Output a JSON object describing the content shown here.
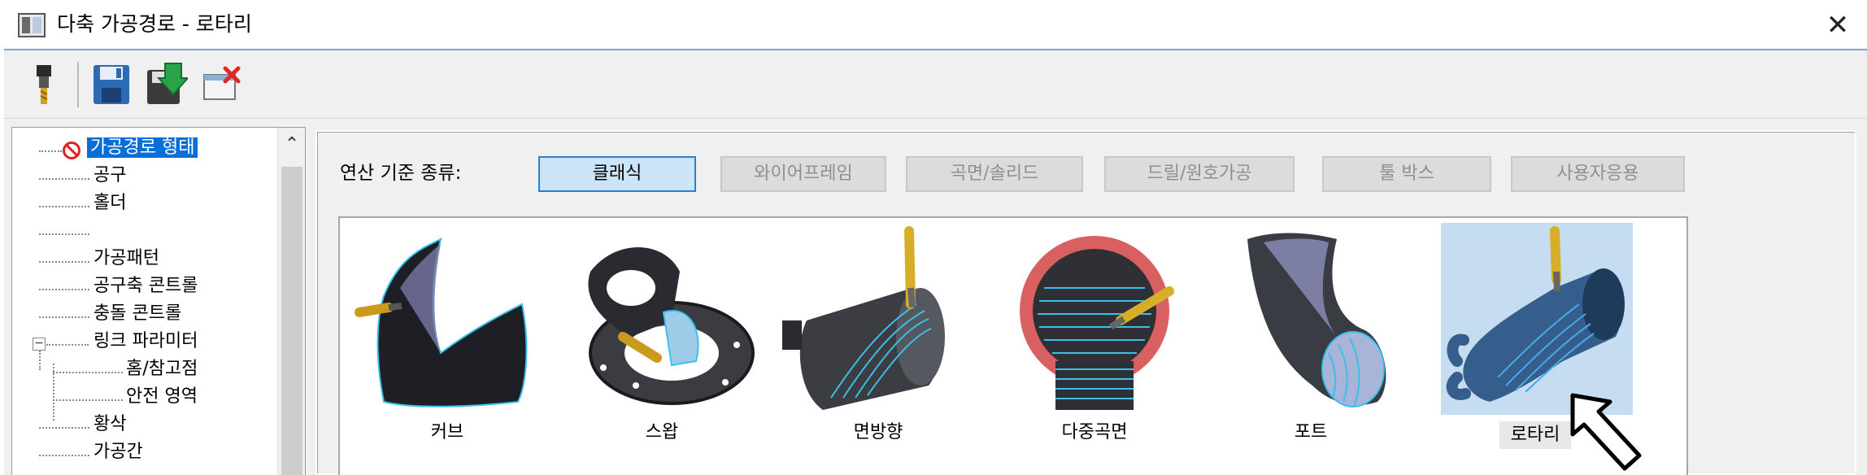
{
  "window": {
    "title": "다축 가공경로 - 로타리",
    "close_label": "✕"
  },
  "toolbar": {
    "buttons": [
      {
        "name": "tool-icon"
      },
      {
        "name": "save-icon"
      },
      {
        "name": "save-apply-icon"
      },
      {
        "name": "cancel-icon"
      }
    ]
  },
  "tree": {
    "items": [
      {
        "label": "가공경로 형태",
        "selected": true
      },
      {
        "label": "공구"
      },
      {
        "label": "홀더"
      },
      {
        "label": ""
      },
      {
        "label": "가공패턴"
      },
      {
        "label": "공구축 콘트롤"
      },
      {
        "label": "충돌 콘트롤"
      },
      {
        "label": "링크 파라미터"
      },
      {
        "label": "홈/참고점"
      },
      {
        "label": "안전 영역"
      },
      {
        "label": "황삭"
      },
      {
        "label": "가공간"
      }
    ]
  },
  "operation": {
    "label": "연산 기준 종류:",
    "categories": [
      {
        "label": "클래식",
        "active": true
      },
      {
        "label": "와이어프레임",
        "active": false
      },
      {
        "label": "곡면/솔리드",
        "active": false
      },
      {
        "label": "드릴/원호가공",
        "active": false
      },
      {
        "label": "툴 박스",
        "active": false
      },
      {
        "label": "사용자응용",
        "active": false
      }
    ]
  },
  "gallery": {
    "tiles": [
      {
        "label": "커브"
      },
      {
        "label": "스왑"
      },
      {
        "label": "면방향"
      },
      {
        "label": "다중곡면"
      },
      {
        "label": "포트"
      },
      {
        "label": "로타리",
        "selected": true
      }
    ]
  },
  "colors": {
    "accent": "#0a6ed8",
    "selected_tile": "#c6dcf0",
    "active_button": "#cce4f7"
  }
}
